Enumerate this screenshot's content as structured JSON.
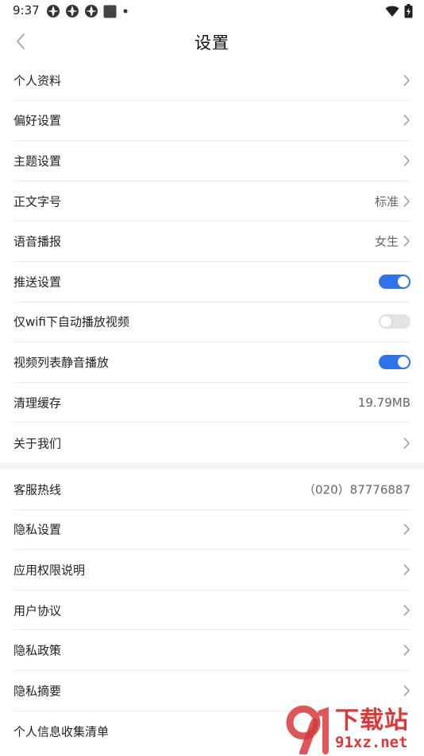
{
  "status_bar": {
    "time": "9:37",
    "left_icons": [
      "notification-app-icon",
      "notification-app-icon",
      "notification-app-icon",
      "notification-square-icon",
      "more-dot-icon"
    ],
    "right_icons": [
      "wifi-icon",
      "battery-charging-icon"
    ]
  },
  "header": {
    "title": "设置"
  },
  "colors": {
    "accent": "#2e73e8",
    "toggle_off": "#e3e3e3",
    "watermark": "#d63a3a"
  },
  "settings": {
    "profile": {
      "label": "个人资料"
    },
    "preferences": {
      "label": "偏好设置"
    },
    "theme": {
      "label": "主题设置"
    },
    "font_size": {
      "label": "正文字号",
      "value": "标准"
    },
    "voice": {
      "label": "语音播报",
      "value": "女生"
    },
    "push": {
      "label": "推送设置",
      "enabled": true
    },
    "wifi_autoplay": {
      "label": "仅wifi下自动播放视频",
      "enabled": false
    },
    "list_mute": {
      "label": "视频列表静音播放",
      "enabled": true
    },
    "cache": {
      "label": "清理缓存",
      "value": "19.79MB"
    },
    "about": {
      "label": "关于我们"
    }
  },
  "legal": {
    "hotline": {
      "label": "客服热线",
      "value": "（020）87776887"
    },
    "privacy_settings": {
      "label": "隐私设置"
    },
    "permissions": {
      "label": "应用权限说明"
    },
    "user_agreement": {
      "label": "用户协议"
    },
    "privacy_policy": {
      "label": "隐私政策"
    },
    "privacy_summary": {
      "label": "隐私摘要"
    },
    "info_collection": {
      "label": "个人信息收集清单"
    }
  },
  "watermark": {
    "name": "下载站",
    "site": "91xz.net"
  }
}
